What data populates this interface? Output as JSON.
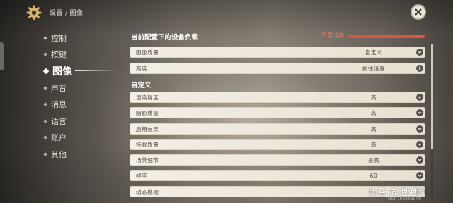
{
  "header": {
    "breadcrumb_root": "设置",
    "breadcrumb_separator": "/",
    "breadcrumb_current": "图像",
    "settings_icon": "gear-icon",
    "close_icon": "close-icon"
  },
  "sidebar": {
    "items": [
      {
        "label": "控制"
      },
      {
        "label": "按键"
      },
      {
        "label": "图像",
        "active": true
      },
      {
        "label": "声音"
      },
      {
        "label": "消息"
      },
      {
        "label": "语言"
      },
      {
        "label": "账户"
      },
      {
        "label": "其他"
      }
    ]
  },
  "load": {
    "title": "当前配置下的设备负载",
    "status": "严重过高",
    "level": 1.0,
    "color": "#e2533f"
  },
  "settings_top": [
    {
      "label": "图像质量",
      "value": "自定义",
      "control": "dropdown"
    },
    {
      "label": "亮度",
      "value": "前往设置",
      "control": "link"
    }
  ],
  "custom": {
    "title": "自定义",
    "rows": [
      {
        "label": "渲染精度",
        "value": "高"
      },
      {
        "label": "阴影质量",
        "value": "高"
      },
      {
        "label": "后期效果",
        "value": "高"
      },
      {
        "label": "特效质量",
        "value": "高"
      },
      {
        "label": "场景细节",
        "value": "极高"
      },
      {
        "label": "帧率",
        "value": "60"
      },
      {
        "label": "动态模糊",
        "value": ""
      }
    ]
  },
  "uid_text": "UID 168868548",
  "watermark": "头条 @泡泡网"
}
